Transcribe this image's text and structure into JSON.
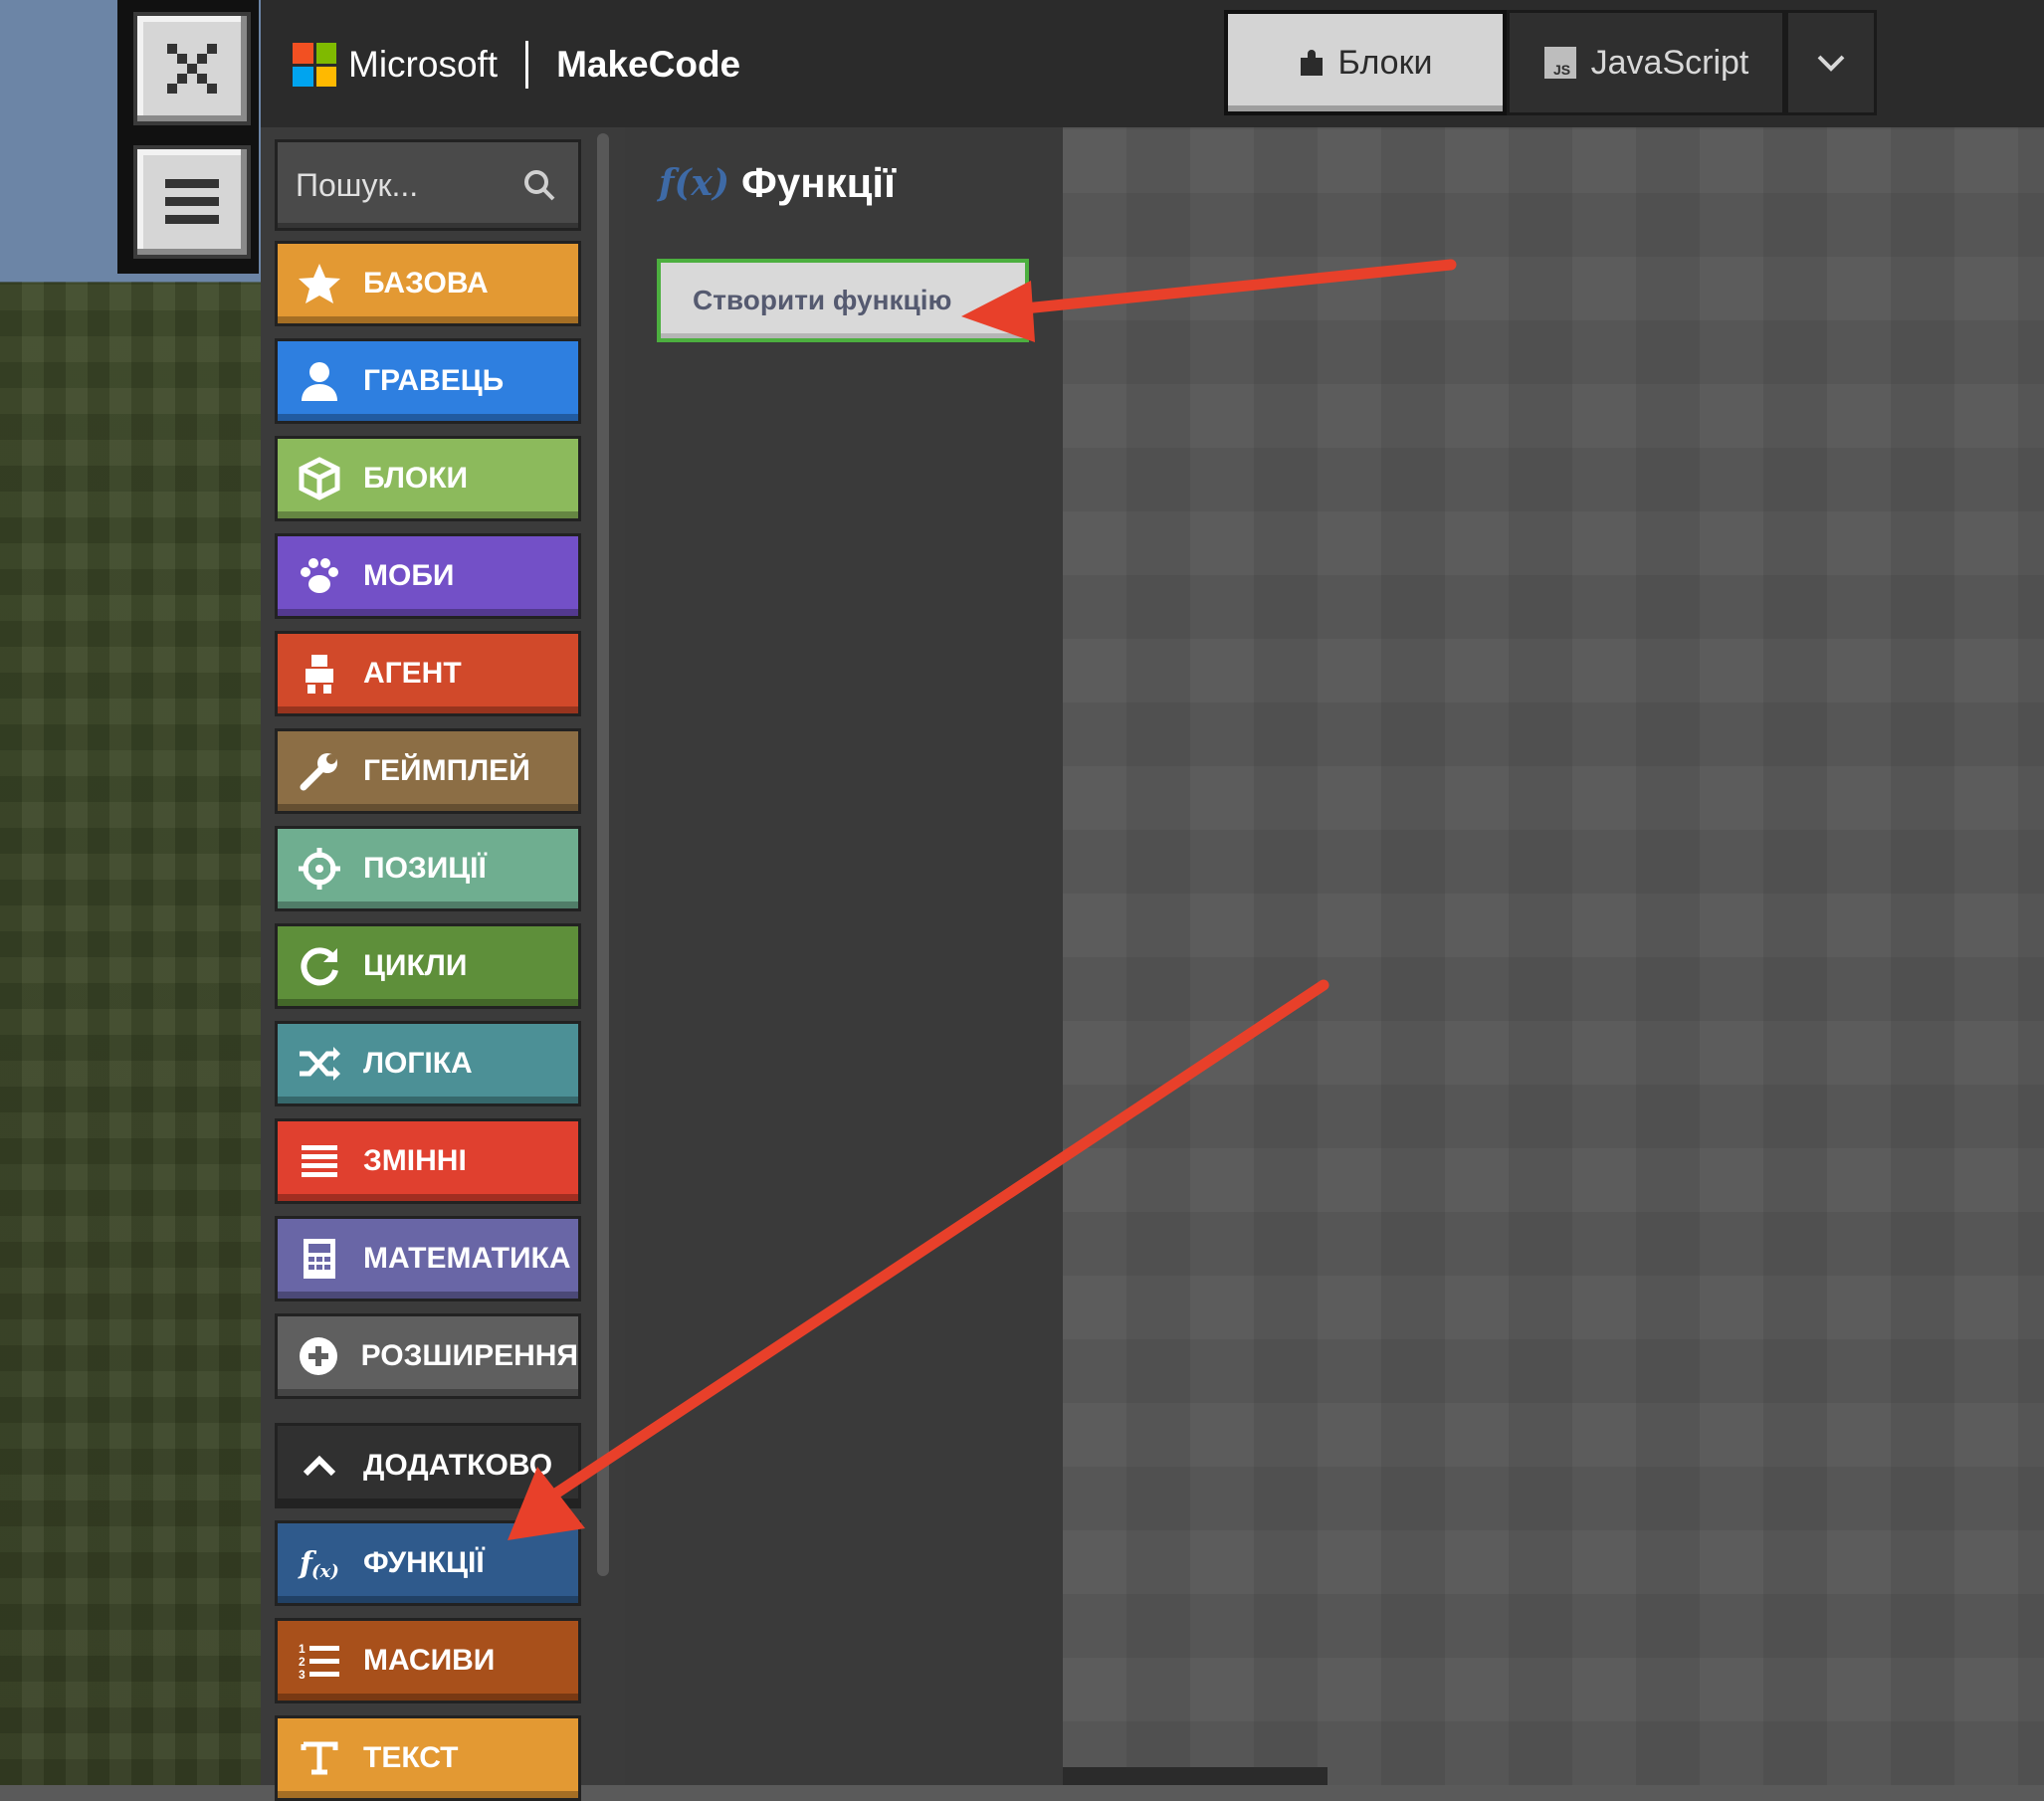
{
  "game_controls": {
    "close_icon": "close-icon",
    "menu_icon": "hamburger-icon"
  },
  "header": {
    "brand_microsoft": "Microsoft",
    "brand_product": "MakeCode",
    "tabs": [
      {
        "label": "Блоки",
        "icon": "puzzle-icon",
        "active": true
      },
      {
        "label": "JavaScript",
        "icon": "js-icon",
        "active": false
      }
    ],
    "more_icon": "chevron-down-icon"
  },
  "toolbox": {
    "search_placeholder": "Пошук...",
    "categories": [
      {
        "label": "БАЗОВА",
        "icon": "star-icon",
        "color": "#e39933"
      },
      {
        "label": "ГРАВЕЦЬ",
        "icon": "person-icon",
        "color": "#2e7fe0"
      },
      {
        "label": "БЛОКИ",
        "icon": "cube-icon",
        "color": "#8cba5c"
      },
      {
        "label": "МОБИ",
        "icon": "paw-icon",
        "color": "#7350c7"
      },
      {
        "label": "АГЕНТ",
        "icon": "agent-icon",
        "color": "#d1492a"
      },
      {
        "label": "ГЕЙМПЛЕЙ",
        "icon": "wrench-icon",
        "color": "#8c6e45"
      },
      {
        "label": "ПОЗИЦІЇ",
        "icon": "crosshair-icon",
        "color": "#6fae90"
      },
      {
        "label": "ЦИКЛИ",
        "icon": "loop-icon",
        "color": "#5e8f3a"
      },
      {
        "label": "ЛОГІКА",
        "icon": "shuffle-icon",
        "color": "#4c9096"
      },
      {
        "label": "ЗМІННІ",
        "icon": "list-icon",
        "color": "#e0402f"
      },
      {
        "label": "МАТЕМАТИКА",
        "icon": "calculator-icon",
        "color": "#6966a6"
      },
      {
        "label": "РОЗШИРЕННЯ",
        "icon": "plus-circle-icon",
        "color": "#5f5f5f"
      },
      {
        "label": "ДОДАТКОВО",
        "icon": "chevron-up-icon",
        "color": "#303030"
      },
      {
        "label": "ФУНКЦІЇ",
        "icon": "function-icon",
        "color": "#2f5a8c"
      },
      {
        "label": "МАСИВИ",
        "icon": "numbered-list-icon",
        "color": "#a8501b"
      },
      {
        "label": "ТЕКСТ",
        "icon": "text-icon",
        "color": "#e39933"
      }
    ]
  },
  "flyout": {
    "icon_text": "f(x)",
    "title": "Функції",
    "create_button": "Створити функцію"
  },
  "annotations": {
    "arrow_color": "#e8402a"
  }
}
